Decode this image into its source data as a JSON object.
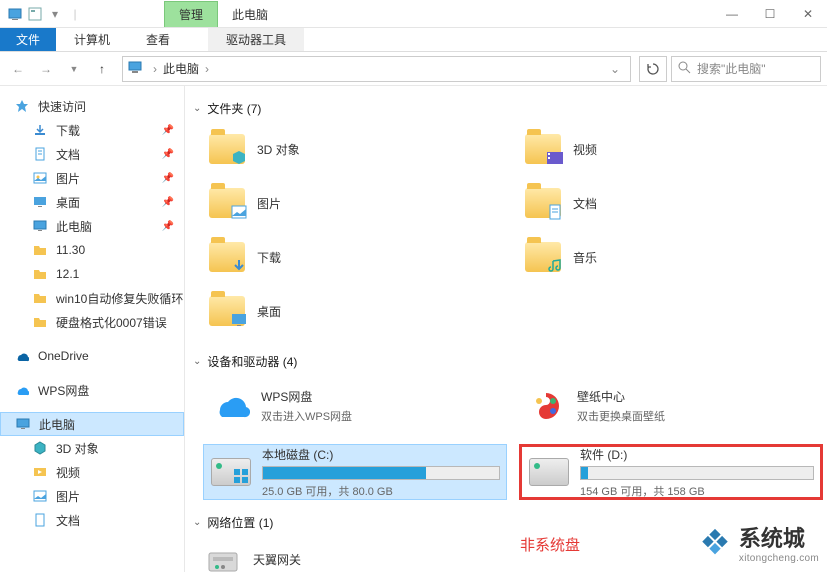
{
  "titlebar": {
    "manage_tab": "管理",
    "window_title": "此电脑"
  },
  "ribbon": {
    "file": "文件",
    "computer": "计算机",
    "view": "查看",
    "drive_tools": "驱动器工具"
  },
  "nav": {
    "breadcrumb_root": "此电脑",
    "search_placeholder": "搜索\"此电脑\""
  },
  "sidebar": {
    "quick_access": "快速访问",
    "downloads": "下载",
    "documents": "文档",
    "pictures": "图片",
    "desktop": "桌面",
    "this_pc": "此电脑",
    "f_1130": "11.30",
    "f_121": "12.1",
    "f_win10": "win10自动修复失败循环",
    "f_hdd": "硬盘格式化0007错误",
    "onedrive": "OneDrive",
    "wps": "WPS网盘",
    "this_pc2": "此电脑",
    "obj3d": "3D 对象",
    "video": "视频",
    "pictures2": "图片",
    "documents2": "文档"
  },
  "groups": {
    "folders": "文件夹 (7)",
    "drives": "设备和驱动器 (4)",
    "network": "网络位置 (1)"
  },
  "folders": {
    "obj3d": "3D 对象",
    "video": "视频",
    "pictures": "图片",
    "documents": "文档",
    "downloads": "下载",
    "music": "音乐",
    "desktop": "桌面"
  },
  "drives": {
    "wps": {
      "title": "WPS网盘",
      "sub": "双击进入WPS网盘"
    },
    "wallpaper": {
      "title": "壁纸中心",
      "sub": "双击更换桌面壁纸"
    },
    "c": {
      "title": "本地磁盘 (C:)",
      "sub": "25.0 GB 可用，共 80.0 GB",
      "used_pct": 69
    },
    "d": {
      "title": "软件 (D:)",
      "sub": "154 GB 可用，共 158 GB",
      "used_pct": 3
    }
  },
  "network": {
    "tianyi": "天翼网关"
  },
  "annotation": "非系统盘",
  "watermark": {
    "title": "系统城",
    "url": "xitongcheng.com"
  }
}
